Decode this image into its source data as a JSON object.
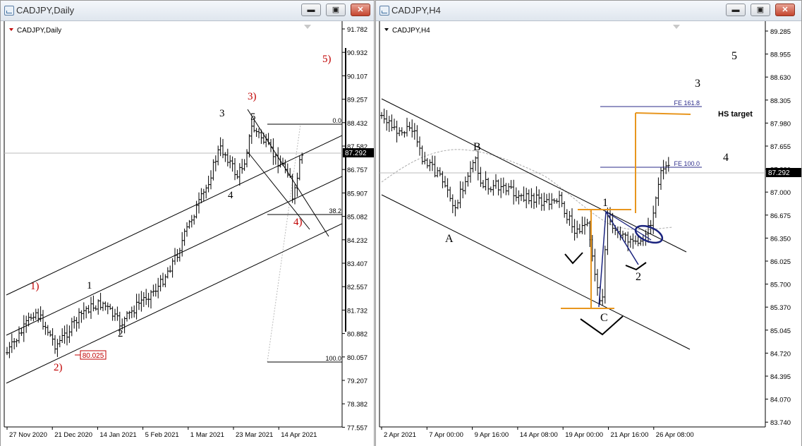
{
  "left_window": {
    "title": "CADJPY,Daily",
    "chart_label": "CADJPY,Daily",
    "price_axis": [
      "91.782",
      "90.932",
      "90.107",
      "89.257",
      "88.432",
      "87.582",
      "86.757",
      "85.907",
      "85.082",
      "84.232",
      "83.407",
      "82.557",
      "81.732",
      "80.882",
      "80.057",
      "79.207",
      "78.382",
      "77.557"
    ],
    "current_price": "87.292",
    "date_axis": [
      "27 Nov 2020",
      "21 Dec 2020",
      "14 Jan 2021",
      "5 Feb 2021",
      "1 Mar 2021",
      "23 Mar 2021",
      "14 Apr 2021"
    ],
    "fib_labels": [
      "0.0",
      "38.2",
      "100.0"
    ],
    "price_tag": "80.025",
    "wave_labels_black": [
      "1",
      "2",
      "3",
      "4",
      "5"
    ],
    "wave_labels_red": [
      "1)",
      "2)",
      "3)",
      "4)",
      "5)"
    ]
  },
  "right_window": {
    "title": "CADJPY,H4",
    "chart_label": "CADJPY,H4",
    "price_axis": [
      "89.285",
      "88.955",
      "88.630",
      "88.305",
      "87.980",
      "87.655",
      "87.330",
      "87.000",
      "86.675",
      "86.350",
      "86.025",
      "85.700",
      "85.370",
      "85.045",
      "84.720",
      "84.395",
      "84.070",
      "83.740"
    ],
    "current_price": "87.292",
    "date_axis": [
      "2 Apr 2021",
      "7 Apr 00:00",
      "9 Apr 16:00",
      "14 Apr 08:00",
      "19 Apr 00:00",
      "21 Apr 16:00",
      "26 Apr 08:00"
    ],
    "fe_labels": [
      "FE 161.8",
      "FE 100.0"
    ],
    "hs_target": "HS target",
    "wave_labels": [
      "A",
      "B",
      "C",
      "1",
      "2",
      "3",
      "4",
      "5"
    ]
  },
  "window_buttons": {
    "minimize": "▬",
    "maximize": "▣",
    "close": "✕"
  },
  "colors": {
    "up_bar": "#000000",
    "annotation_red": "#c00000",
    "orange": "#e8961e",
    "navy": "#1a237e",
    "fe_blue": "#2b2b8a"
  },
  "chart_data": [
    {
      "type": "line",
      "title": "CADJPY,Daily",
      "x": [
        "27 Nov 2020",
        "21 Dec 2020",
        "14 Jan 2021",
        "5 Feb 2021",
        "1 Mar 2021",
        "23 Mar 2021",
        "14 Apr 2021"
      ],
      "ylim": [
        77.557,
        91.782
      ],
      "last_price": 87.292
    },
    {
      "type": "line",
      "title": "CADJPY,H4",
      "x": [
        "2 Apr 2021",
        "7 Apr 00:00",
        "9 Apr 16:00",
        "14 Apr 08:00",
        "19 Apr 00:00",
        "21 Apr 16:00",
        "26 Apr 08:00"
      ],
      "ylim": [
        83.74,
        89.285
      ],
      "last_price": 87.292
    }
  ]
}
